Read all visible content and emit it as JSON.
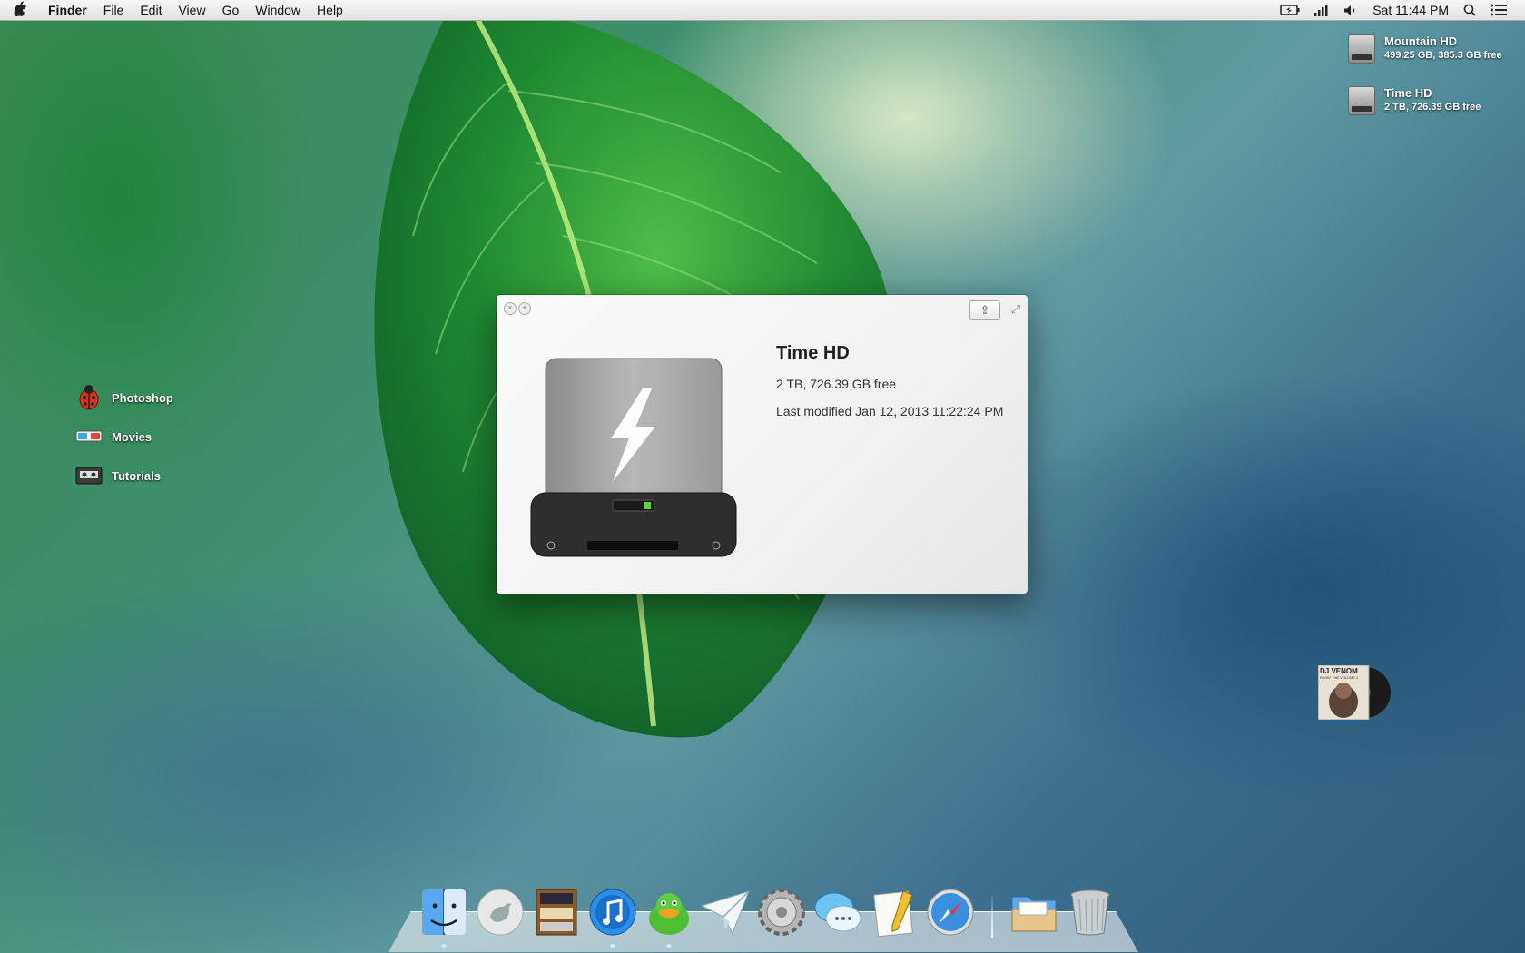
{
  "menubar": {
    "app_name": "Finder",
    "menus": [
      "File",
      "Edit",
      "View",
      "Go",
      "Window",
      "Help"
    ],
    "clock": "Sat 11:44 PM",
    "status_icons": [
      "battery-icon",
      "wifi-signal-icon",
      "volume-icon",
      "spotlight-icon",
      "notification-center-icon"
    ]
  },
  "desktop_drives": [
    {
      "name": "Mountain HD",
      "info": "499.25 GB, 385.3 GB free"
    },
    {
      "name": "Time HD",
      "info": "2 TB, 726.39 GB free"
    }
  ],
  "desktop_items": [
    {
      "label": "Photoshop",
      "icon": "ladybug-icon"
    },
    {
      "label": "Movies",
      "icon": "3d-glasses-icon"
    },
    {
      "label": "Tutorials",
      "icon": "tape-icon"
    }
  ],
  "quicklook": {
    "title": "Time HD",
    "size": "2 TB, 726.39 GB free",
    "modified": "Last modified Jan 12, 2013 11:22:24 PM"
  },
  "album": {
    "cover_text": "DJ VENOM",
    "cover_sub": "RAISE THE VOLUME 2"
  },
  "dock": {
    "apps": [
      "finder-icon",
      "twitter-icon",
      "bookshelf-icon",
      "itunes-icon",
      "adium-duck-icon",
      "mail-paper-plane-icon",
      "system-preferences-icon",
      "messages-icon",
      "textedit-icon",
      "safari-icon"
    ],
    "stacks": [
      "documents-folder-icon",
      "trash-icon"
    ]
  }
}
